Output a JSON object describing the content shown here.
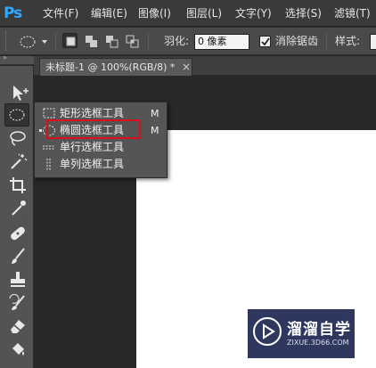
{
  "app": {
    "logo": "Ps"
  },
  "menu": {
    "items": [
      {
        "label": "文件(F)",
        "name": "menu-file"
      },
      {
        "label": "编辑(E)",
        "name": "menu-edit"
      },
      {
        "label": "图像(I)",
        "name": "menu-image"
      },
      {
        "label": "图层(L)",
        "name": "menu-layer"
      },
      {
        "label": "文字(Y)",
        "name": "menu-type"
      },
      {
        "label": "选择(S)",
        "name": "menu-select"
      },
      {
        "label": "滤镜(T)",
        "name": "menu-filter"
      }
    ]
  },
  "options": {
    "feather_label": "羽化:",
    "feather_value": "0 像素",
    "antialias_label": "消除锯齿",
    "antialias_checked": true,
    "style_label": "样式:"
  },
  "document": {
    "tab_title": "未标题-1 @ 100%(RGB/8) *",
    "close_glyph": "×"
  },
  "tools_header": "»",
  "flyout": {
    "items": [
      {
        "label": "矩形选框工具",
        "shortcut": "M",
        "icon": "rect-marquee-icon"
      },
      {
        "label": "椭圆选框工具",
        "shortcut": "M",
        "icon": "ellipse-marquee-icon",
        "current": true
      },
      {
        "label": "单行选框工具",
        "shortcut": "",
        "icon": "single-row-marquee-icon"
      },
      {
        "label": "单列选框工具",
        "shortcut": "",
        "icon": "single-column-marquee-icon"
      }
    ]
  },
  "watermark": {
    "title": "溜溜自学",
    "url": "ZIXUE.3D66.COM"
  },
  "colors": {
    "highlight": "#d8101b",
    "ps_blue": "#31a8ff",
    "panel": "#535353"
  }
}
